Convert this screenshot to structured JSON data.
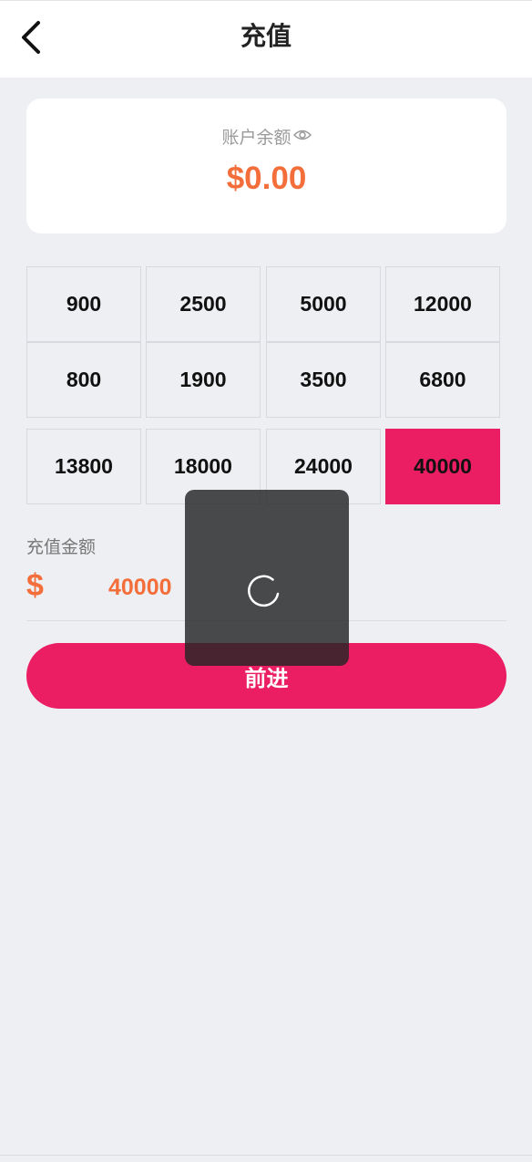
{
  "header": {
    "title": "充值",
    "back_icon": "chevron-left-icon"
  },
  "balance": {
    "label": "账户余额",
    "eye_icon": "eye-icon",
    "value": "$0.00"
  },
  "amounts": [
    {
      "label": "900",
      "selected": false
    },
    {
      "label": "2500",
      "selected": false
    },
    {
      "label": "5000",
      "selected": false
    },
    {
      "label": "12000",
      "selected": false
    },
    {
      "label": "800",
      "selected": false
    },
    {
      "label": "1900",
      "selected": false
    },
    {
      "label": "3500",
      "selected": false
    },
    {
      "label": "6800",
      "selected": false
    },
    {
      "label": "13800",
      "selected": false
    },
    {
      "label": "18000",
      "selected": false
    },
    {
      "label": "24000",
      "selected": false
    },
    {
      "label": "40000",
      "selected": true
    }
  ],
  "recharge": {
    "label": "充值金额",
    "currency": "$",
    "value": "40000"
  },
  "submit": {
    "label": "前进"
  },
  "loading": {
    "icon": "spinner-icon"
  },
  "colors": {
    "accent": "#eb1e63",
    "amount": "#f36e3a",
    "background": "#eeeff3"
  }
}
